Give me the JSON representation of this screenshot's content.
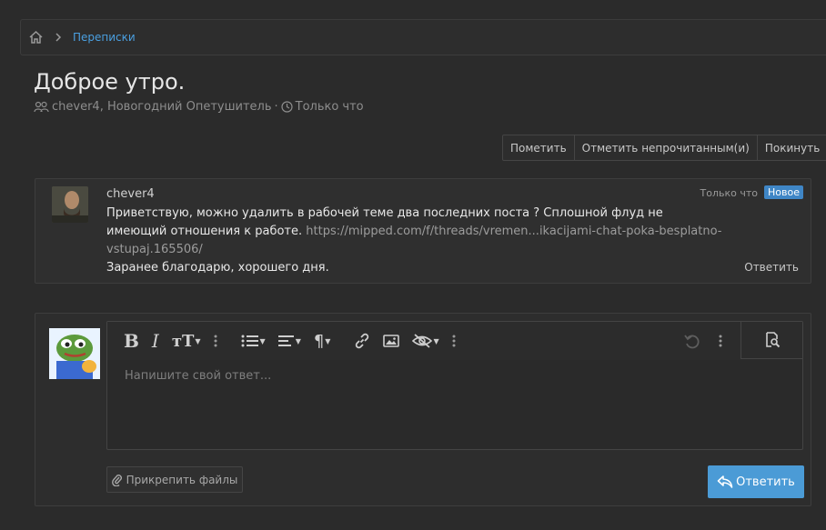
{
  "breadcrumb": {
    "home_icon": "home-icon",
    "items": [
      "Переписки"
    ]
  },
  "conversation": {
    "title": "Доброе утро.",
    "participants": "chever4, Новогодний Опетушитель",
    "separator": "·",
    "time": "Только что"
  },
  "actions": {
    "mark": "Пометить",
    "mark_unread": "Отметить непрочитанным(и)",
    "leave": "Покинуть"
  },
  "message": {
    "author": "chever4",
    "time": "Только что",
    "badge": "Новое",
    "line1": "Приветствую, можно удалить в рабочей теме два последних поста ? Сплошной флуд не",
    "line2": "имеющий отношения к работе. ",
    "link": "https://mipped.com/f/threads/vremen...ikacijami-chat-poka-besplatno-vstupaj.165506/",
    "line3": "Заранее благодарю, хорошего дня.",
    "reply": "Ответить"
  },
  "editor": {
    "placeholder": "Напишите свой ответ...",
    "attach_label": "Прикрепить файлы",
    "submit_label": "Ответить",
    "toolbar_icons": [
      "bold-icon",
      "italic-icon",
      "text-size-icon",
      "more-icon",
      "list-icon",
      "align-icon",
      "paragraph-icon",
      "link-icon",
      "image-icon",
      "spoiler-icon",
      "more-icon",
      "undo-icon",
      "more-icon",
      "preview-icon"
    ]
  },
  "colors": {
    "accent": "#4b9bd6",
    "badge": "#3f86c6",
    "link": "#4a9fe0",
    "background": "#2b2b2b"
  }
}
